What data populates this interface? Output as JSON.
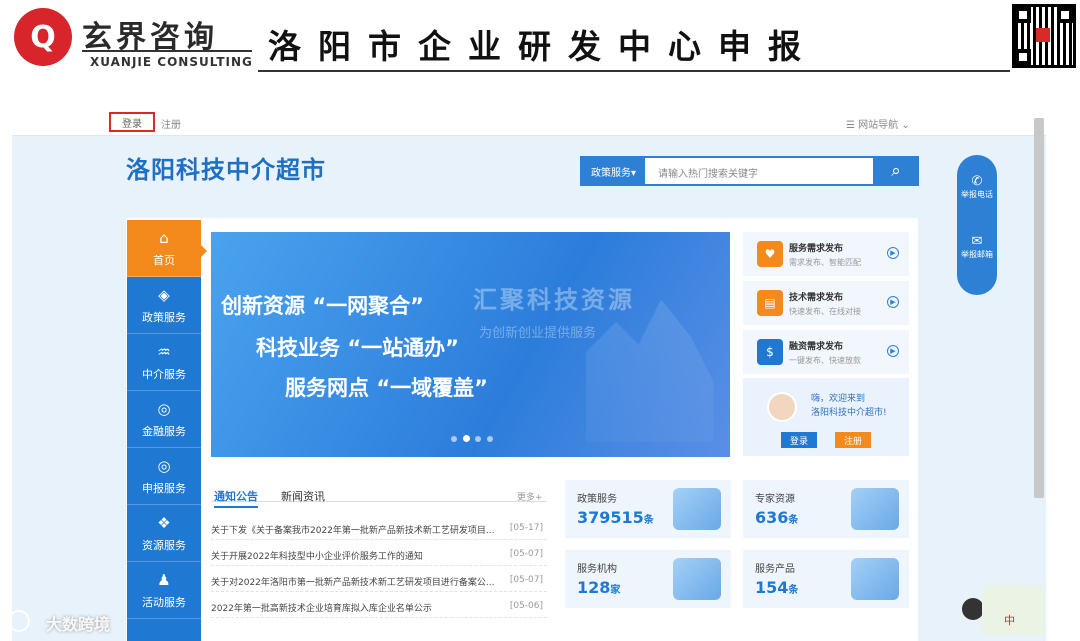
{
  "header": {
    "logo_glyph": "Q",
    "brand_cn": "玄界咨询",
    "brand_en": "XUANJIE CONSULTING",
    "title": "洛阳市企业研发中心申报"
  },
  "topbar": {
    "login": "登录",
    "register": "注册",
    "nav_guide": "☰ 网站导航 ⌄"
  },
  "site": {
    "title": "洛阳科技中介超市",
    "search": {
      "scope": "政策服务▾",
      "placeholder": "请输入热门搜索关键字",
      "icon": "search-icon"
    }
  },
  "sidenav": [
    {
      "label": "首页",
      "icon": "home-icon",
      "glyph": "⌂"
    },
    {
      "label": "政策服务",
      "icon": "layers-icon",
      "glyph": "◈"
    },
    {
      "label": "中介服务",
      "icon": "handshake-icon",
      "glyph": "♒"
    },
    {
      "label": "金融服务",
      "icon": "coin-icon",
      "glyph": "◎"
    },
    {
      "label": "申报服务",
      "icon": "coin-icon",
      "glyph": "◎"
    },
    {
      "label": "资源服务",
      "icon": "resources-icon",
      "glyph": "❖"
    },
    {
      "label": "活动服务",
      "icon": "group-icon",
      "glyph": "♟"
    }
  ],
  "banner": {
    "lines": [
      {
        "a": "创新资源",
        "b": "“一网聚合”"
      },
      {
        "a": "科技业务",
        "b": "“一站通办”"
      },
      {
        "a": "服务网点",
        "b": "“一域覆盖”"
      }
    ],
    "slogan": "汇聚科技资源",
    "slogan_sub": "为创新创业提供服务",
    "dots": 4,
    "active_dot": 1
  },
  "services": [
    {
      "title": "服务需求发布",
      "sub": "需求发布、智能匹配",
      "color": "#f48a1c",
      "icon": "hand-heart-icon",
      "glyph": "♥"
    },
    {
      "title": "技术需求发布",
      "sub": "快速发布、在线对接",
      "color": "#f48a1c",
      "icon": "document-icon",
      "glyph": "▤"
    },
    {
      "title": "融资需求发布",
      "sub": "一键发布、快速放款",
      "color": "#1f78d1",
      "icon": "coins-icon",
      "glyph": "$"
    }
  ],
  "welcome": {
    "line1": "嗨，欢迎来到",
    "line2": "洛阳科技中介超市!",
    "login": "登录",
    "register": "注册"
  },
  "news": {
    "tabs": [
      "通知公告",
      "新闻资讯"
    ],
    "more": "更多+",
    "items": [
      {
        "title": "关于下发《关于备案我市2022年第一批新产品新技术新工艺研发项目...",
        "date": "[05-17]"
      },
      {
        "title": "关于开展2022年科技型中小企业评价服务工作的通知",
        "date": "[05-07]"
      },
      {
        "title": "关于对2022年洛阳市第一批新产品新技术新工艺研发项目进行备案公...",
        "date": "[05-07]"
      },
      {
        "title": "2022年第一批高新技术企业培育库拟入库企业名单公示",
        "date": "[05-06]"
      }
    ]
  },
  "stats": [
    {
      "label": "政策服务",
      "value": "379515",
      "unit": "条",
      "icon": "policy-illustration"
    },
    {
      "label": "专家资源",
      "value": "636",
      "unit": "条",
      "icon": "expert-illustration"
    },
    {
      "label": "服务机构",
      "value": "128",
      "unit": "家",
      "icon": "building-illustration"
    },
    {
      "label": "服务产品",
      "value": "154",
      "unit": "条",
      "icon": "product-illustration"
    }
  ],
  "float": {
    "phone": "举报电话",
    "mail": "举报邮箱"
  },
  "watermark": "大数跨境",
  "corner": "中"
}
